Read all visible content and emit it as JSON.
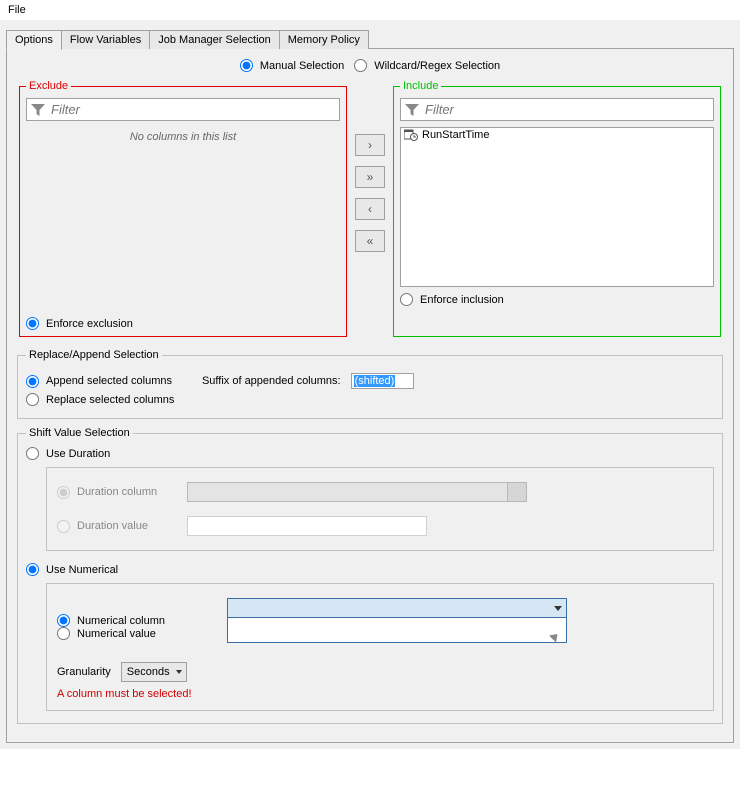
{
  "menubar": {
    "file": "File"
  },
  "tabs": [
    "Options",
    "Flow Variables",
    "Job Manager Selection",
    "Memory Policy"
  ],
  "selection_mode": {
    "manual": "Manual Selection",
    "wildcard": "Wildcard/Regex Selection"
  },
  "exclude": {
    "legend": "Exclude",
    "filter_placeholder": "Filter",
    "empty_text": "No columns in this list",
    "enforce": "Enforce exclusion"
  },
  "include": {
    "legend": "Include",
    "filter_placeholder": "Filter",
    "items": [
      "RunStartTime"
    ],
    "enforce": "Enforce inclusion"
  },
  "arrows": {
    "right": "›",
    "right_all": "»",
    "left": "‹",
    "left_all": "«"
  },
  "replace_append": {
    "legend": "Replace/Append Selection",
    "append": "Append selected columns",
    "replace": "Replace selected columns",
    "suffix_label": "Suffix of appended columns:",
    "suffix_value": "(shifted)"
  },
  "shift": {
    "legend": "Shift Value Selection",
    "use_duration": "Use Duration",
    "duration_column": "Duration column",
    "duration_value": "Duration value",
    "use_numerical": "Use Numerical",
    "numerical_column": "Numerical column",
    "numerical_value": "Numerical value",
    "granularity_label": "Granularity",
    "granularity_value": "Seconds",
    "error": "A column must be selected!"
  }
}
